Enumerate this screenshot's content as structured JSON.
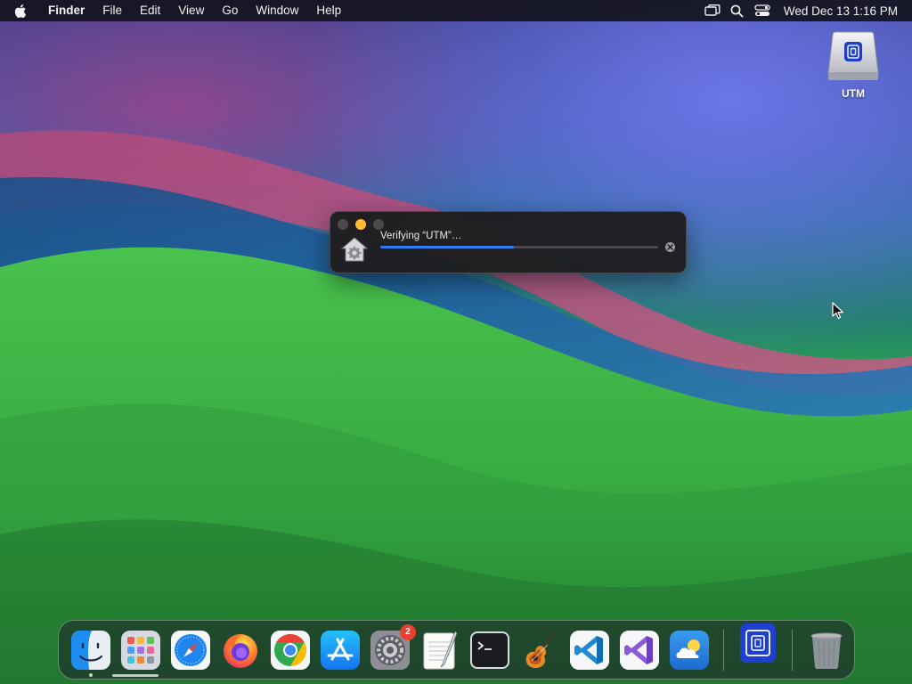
{
  "menubar": {
    "app_name": "Finder",
    "items": [
      "File",
      "Edit",
      "View",
      "Go",
      "Window",
      "Help"
    ],
    "status_icons": [
      "screen-mirroring-icon",
      "search-icon",
      "control-center-icon"
    ],
    "clock": "Wed Dec 13  1:16 PM"
  },
  "desktop": {
    "icons": [
      {
        "label": "UTM",
        "icon": "utm-drive-icon"
      }
    ]
  },
  "progress_window": {
    "title": "Verifying “UTM”…",
    "progress": 0.48,
    "controls": [
      "close-icon",
      "minimize-icon",
      "zoom-icon"
    ]
  },
  "dock": {
    "apps": [
      {
        "name": "Finder",
        "icon": "finder-icon",
        "running": true
      },
      {
        "name": "Launchpad",
        "icon": "launchpad-icon"
      },
      {
        "name": "Safari",
        "icon": "safari-icon"
      },
      {
        "name": "Firefox",
        "icon": "firefox-icon"
      },
      {
        "name": "Google Chrome",
        "icon": "chrome-icon"
      },
      {
        "name": "App Store",
        "icon": "app-store-icon"
      },
      {
        "name": "System Settings",
        "icon": "system-settings-icon",
        "badge": "2"
      },
      {
        "name": "TextEdit",
        "icon": "textedit-icon"
      },
      {
        "name": "Terminal",
        "icon": "terminal-icon"
      },
      {
        "name": "GarageBand",
        "icon": "garageband-icon"
      },
      {
        "name": "Visual Studio Code",
        "icon": "vscode-icon"
      },
      {
        "name": "Visual Studio",
        "icon": "visual-studio-icon"
      },
      {
        "name": "Weather",
        "icon": "weather-icon"
      },
      {
        "name": "UTM",
        "icon": "utm-icon"
      },
      {
        "name": "Trash",
        "icon": "trash-icon"
      }
    ]
  },
  "colors": {
    "accent": "#2f7cf6",
    "badge": "#e9402f",
    "minimize": "#febc2e"
  }
}
